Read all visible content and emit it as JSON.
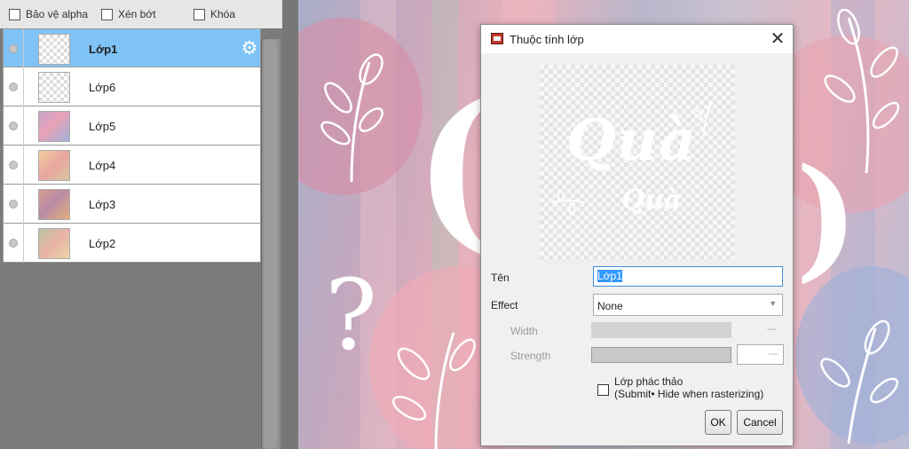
{
  "layer_options": {
    "alpha_protect": "Bảo vệ alpha",
    "clip": "Xén bớt",
    "lock": "Khóa"
  },
  "layers": [
    {
      "name": "Lớp1",
      "selected": true
    },
    {
      "name": "Lớp6",
      "selected": false
    },
    {
      "name": "Lớp5",
      "selected": false
    },
    {
      "name": "Lớp4",
      "selected": false
    },
    {
      "name": "Lớp3",
      "selected": false
    },
    {
      "name": "Lớp2",
      "selected": false
    }
  ],
  "icons": {
    "gear": "⚙",
    "close": "✕",
    "dropdown": "▼"
  },
  "dialog": {
    "title": "Thuộc tính lớp",
    "preview_text_main": "Quà",
    "preview_text_sub": "Quà",
    "name_label": "Tên",
    "name_value": "Lớp1",
    "effect_label": "Effect",
    "effect_value": "None",
    "width_label": "Width",
    "width_value": "---",
    "strength_label": "Strength",
    "strength_value": "---",
    "draft_label_line1": "Lớp phác thảo",
    "draft_label_line2": "(Submit• Hide when rasterizing)",
    "ok": "OK",
    "cancel": "Cancel"
  },
  "colors": {
    "selected_row": "#7fc3f7",
    "input_focus": "#3c8fd8",
    "selection_highlight": "#3399ff"
  }
}
